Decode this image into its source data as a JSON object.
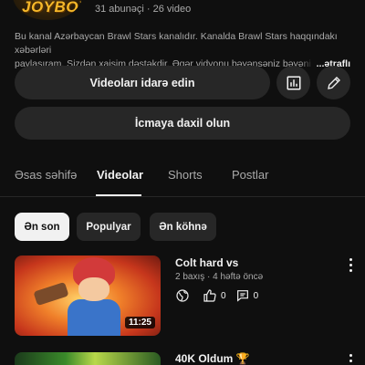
{
  "channel": {
    "avatar_text": "JOYBOY",
    "stats": "31 abunəçi · 26 video",
    "description_line1": "Bu kanal Azərbaycan Brawl Stars kanalıdır. Kanalda Brawl Stars haqqındakı xəbərləri",
    "description_line2": "paylaşıram. Sizdən xaişim dəstəkdir. Əgər vidyonu bəyənsəniz bəyəni düy",
    "more_label": "...ətraflı"
  },
  "actions": {
    "manage_label": "Videoları idarə edin",
    "join_label": "İcmaya daxil olun",
    "analytics_icon": "bar-chart-icon",
    "edit_icon": "pencil-icon"
  },
  "tabs": [
    {
      "label": "Əsas səhifə",
      "active": false
    },
    {
      "label": "Videolar",
      "active": true
    },
    {
      "label": "Shorts",
      "active": false
    },
    {
      "label": "Postlar",
      "active": false
    }
  ],
  "sort_chips": [
    {
      "label": "Ən son",
      "active": true
    },
    {
      "label": "Populyar",
      "active": false
    },
    {
      "label": "Ən köhnə",
      "active": false
    }
  ],
  "videos": [
    {
      "title": "Colt hard vs",
      "meta": "2 baxış · 4 həftə öncə",
      "duration": "11:25",
      "likes": "0",
      "comments": "0",
      "visibility_icon": "globe-icon"
    },
    {
      "title": "40K Oldum 🏆"
    }
  ],
  "colors": {
    "background": "#0f0f0f",
    "surface": "#272727",
    "text_primary": "#f1f1f1",
    "text_secondary": "#aaaaaa"
  }
}
